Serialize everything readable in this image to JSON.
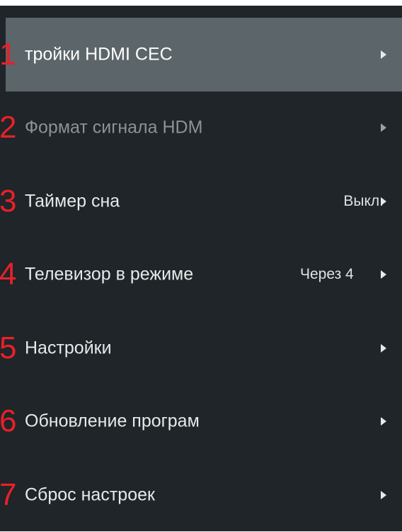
{
  "menu": {
    "items": [
      {
        "number": "1",
        "label": "тройки HDMI CEC",
        "value": ""
      },
      {
        "number": "2",
        "label": "Формат сигнала HDM",
        "value": ""
      },
      {
        "number": "3",
        "label": "Таймер сна",
        "value": "Выкл."
      },
      {
        "number": "4",
        "label": "Телевизор в режиме",
        "value": "Через 4"
      },
      {
        "number": "5",
        "label": "Настройки",
        "value": ""
      },
      {
        "number": "6",
        "label": "Обновление програм",
        "value": ""
      },
      {
        "number": "7",
        "label": "Сброс настроек",
        "value": ""
      }
    ],
    "selected_index": 0,
    "dimmed_index": 1
  },
  "colors": {
    "background": "#1f2528",
    "selected_row": "#5c6569",
    "annotation_number": "#e8202a",
    "text": "#e7e9ea"
  },
  "icons": {
    "row_arrow": "chevron-right-icon"
  }
}
